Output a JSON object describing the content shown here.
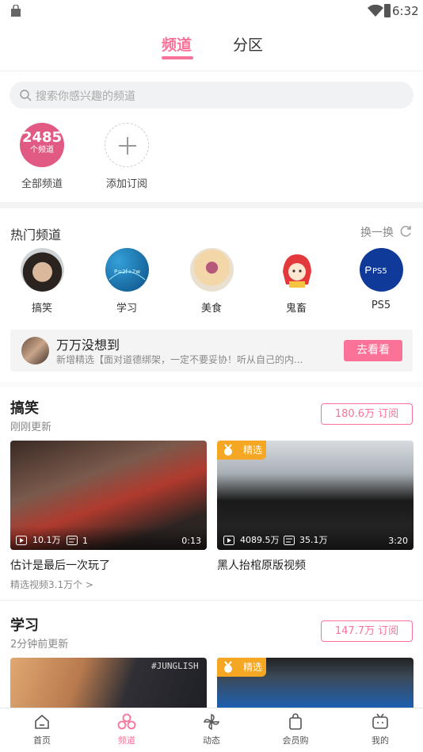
{
  "status": {
    "time": "6:32"
  },
  "top_tabs": [
    {
      "label": "频道",
      "active": true
    },
    {
      "label": "分区",
      "active": false
    }
  ],
  "search": {
    "placeholder": "搜索你感兴趣的频道"
  },
  "subscriptions": {
    "all": {
      "count": "2485",
      "unit": "个频道",
      "label": "全部频道"
    },
    "add": {
      "label": "添加订阅"
    }
  },
  "hot": {
    "title": "热门频道",
    "refresh_label": "换一换",
    "channels": [
      {
        "label": "搞笑",
        "icon": "person-avatar"
      },
      {
        "label": "学习",
        "icon": "formula-board"
      },
      {
        "label": "美食",
        "icon": "cake"
      },
      {
        "label": "鬼畜",
        "icon": "anime-girl"
      },
      {
        "label": "PS5",
        "icon": "ps5-logo",
        "logo_text": "PS5"
      }
    ]
  },
  "promo": {
    "title": "万万没想到",
    "desc": "新增精选【面对道德绑架，一定不要妥协！听从自己的内...",
    "button": "去看看"
  },
  "sections": [
    {
      "title": "搞笑",
      "subtitle": "刚刚更新",
      "subscribe": "180.6万 订阅",
      "videos": [
        {
          "views": "10.1万",
          "danmaku": "1",
          "duration": "0:13",
          "title": "估计是最后一次玩了",
          "badge": ""
        },
        {
          "views": "4089.5万",
          "danmaku": "35.1万",
          "duration": "3:20",
          "title": "黑人抬棺原版视频",
          "badge": "精选"
        }
      ],
      "more": "精选视频3.1万个 >"
    },
    {
      "title": "学习",
      "subtitle": "2分钟前更新",
      "subscribe": "147.7万 订阅",
      "videos": [
        {
          "badge": "",
          "overlay_text": "#JUNGLISH"
        },
        {
          "badge": "精选"
        }
      ]
    }
  ],
  "bottom_nav": [
    {
      "label": "首页",
      "icon": "home-icon"
    },
    {
      "label": "频道",
      "icon": "channel-icon",
      "active": true
    },
    {
      "label": "动态",
      "icon": "pinwheel-icon"
    },
    {
      "label": "会员购",
      "icon": "shopping-bag-icon"
    },
    {
      "label": "我的",
      "icon": "tv-icon"
    }
  ],
  "colors": {
    "accent": "#fb7299",
    "badge": "#f5a623"
  }
}
